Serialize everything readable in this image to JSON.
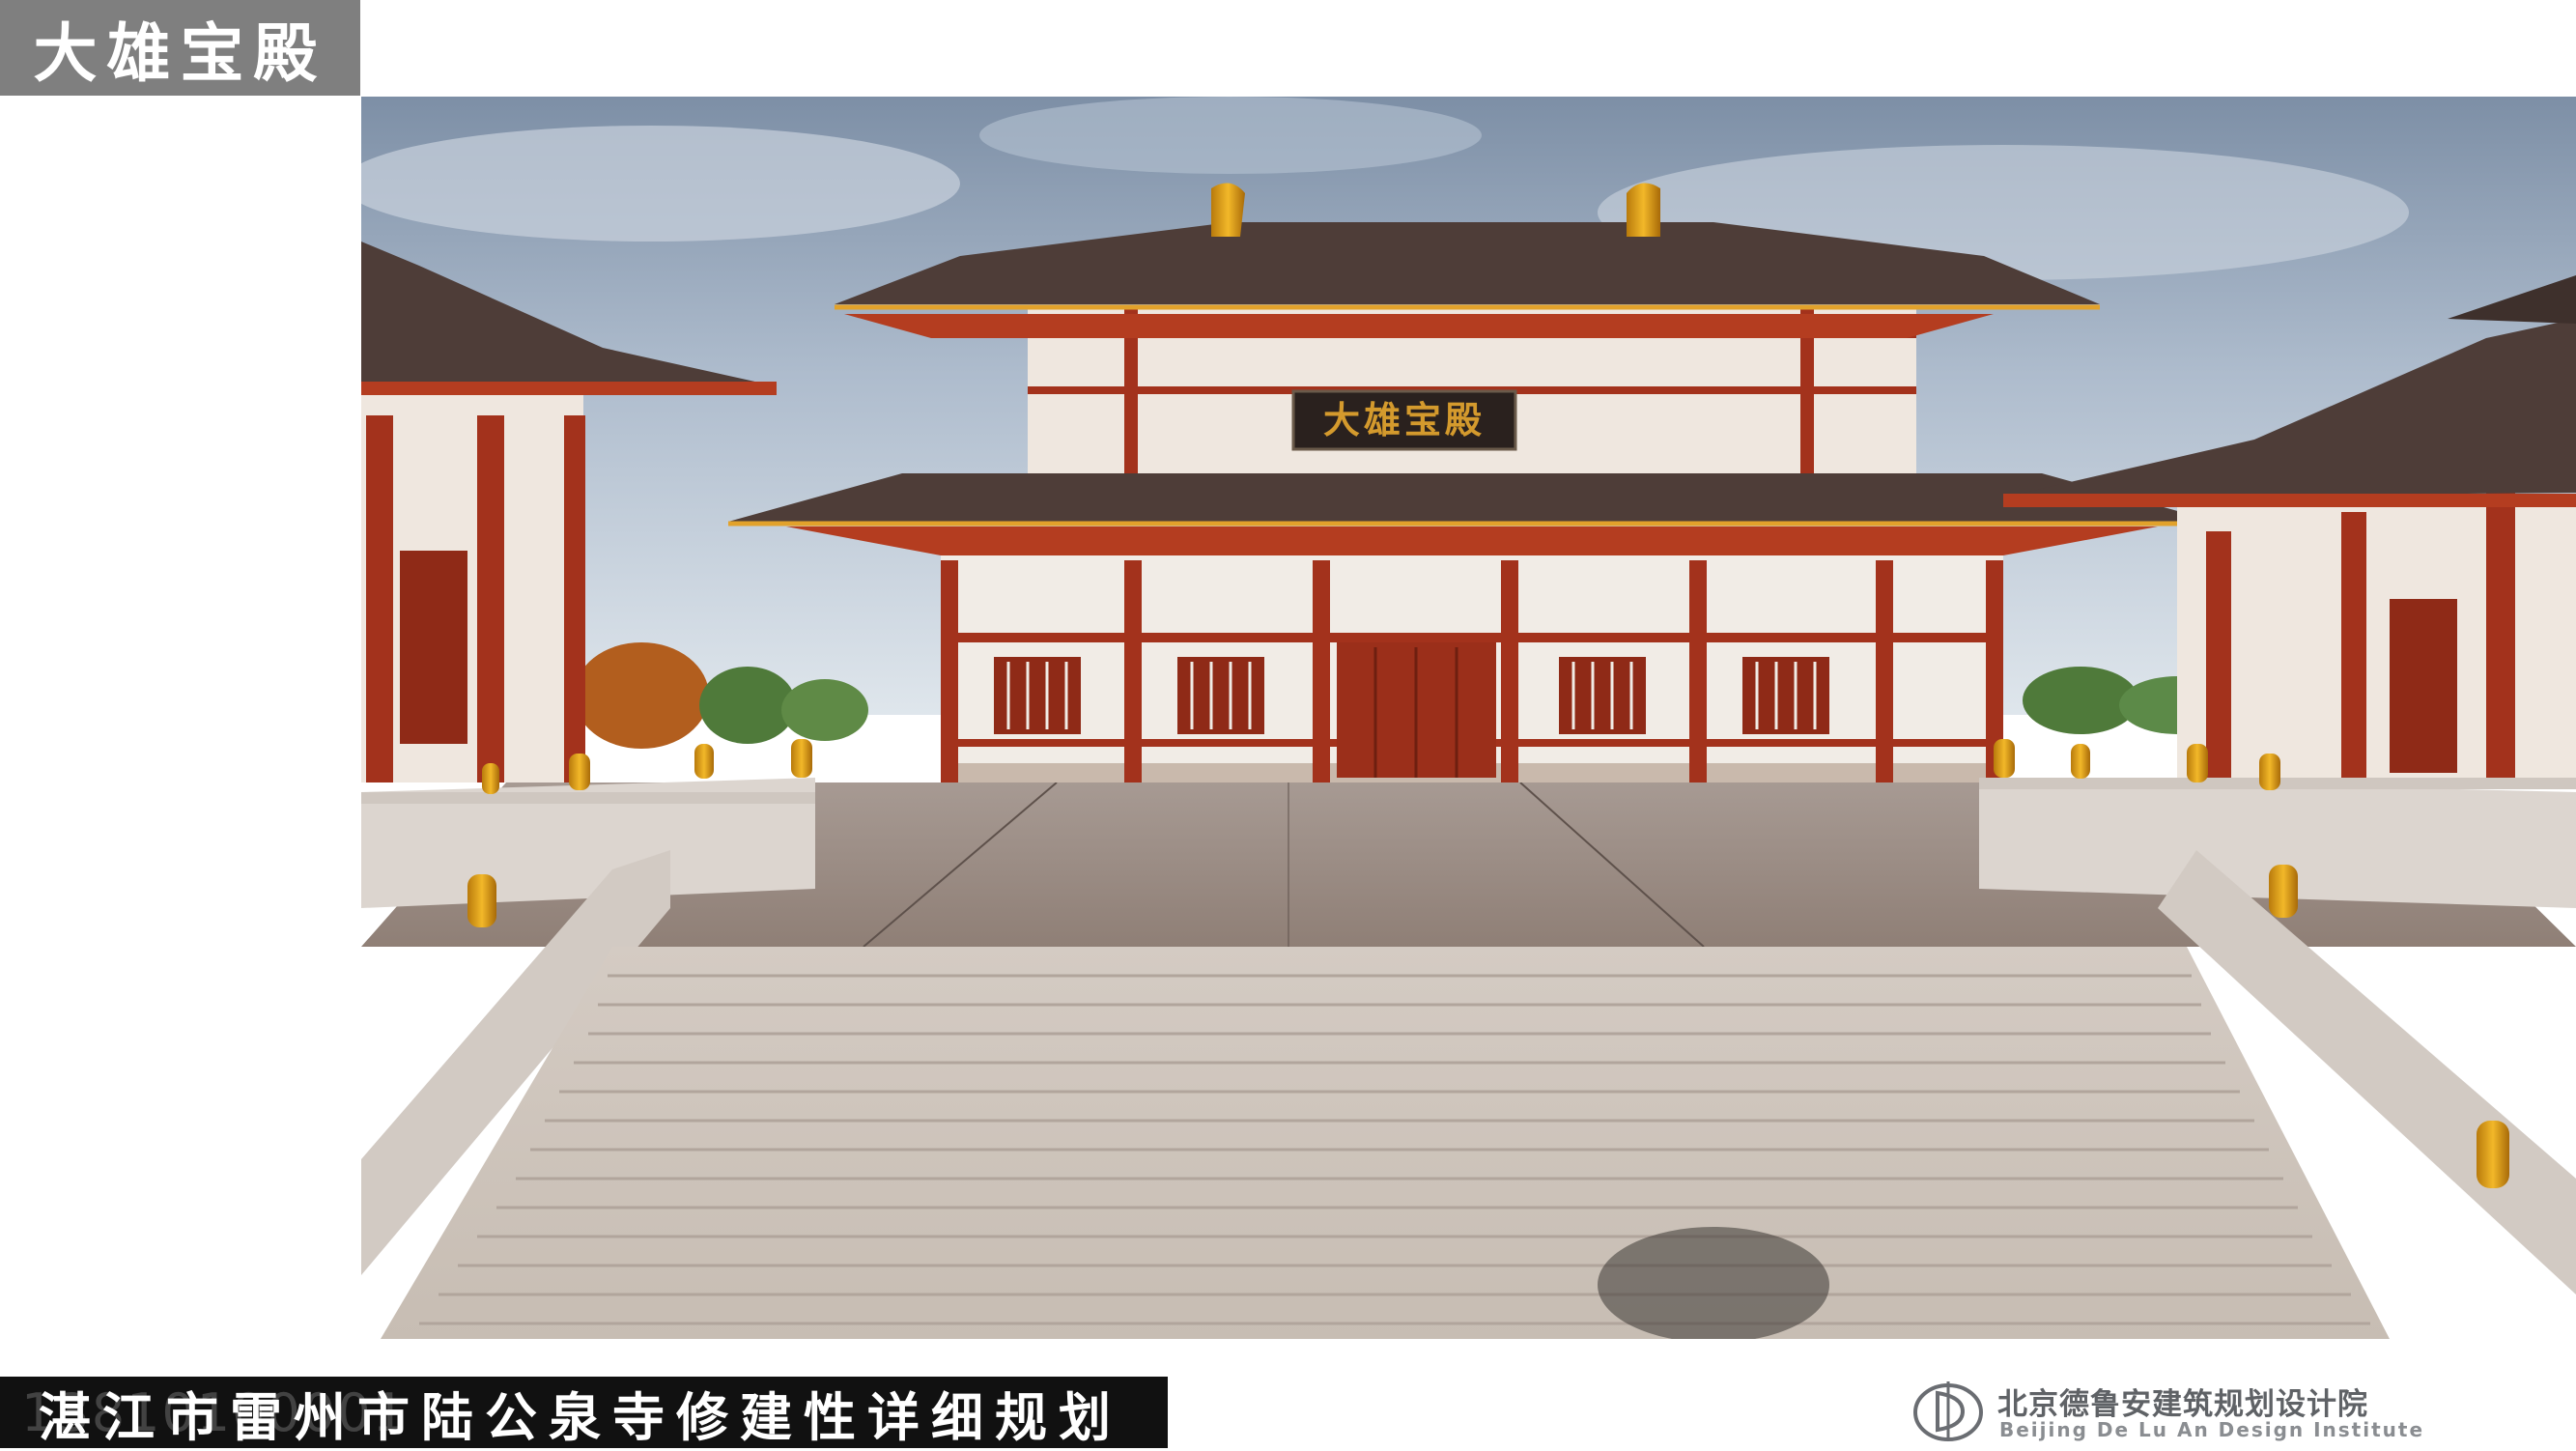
{
  "slide": {
    "title": "大雄宝殿"
  },
  "render": {
    "plaque_text": "大雄宝殿"
  },
  "footer": {
    "project_title": "湛江市雷州市陆公泉寺修建性详细规划",
    "phone_watermark": "13810100001",
    "institute_name_cn": "北京德鲁安建筑规划设计院",
    "institute_name_en": "Beijing De Lu An Design Institute"
  }
}
